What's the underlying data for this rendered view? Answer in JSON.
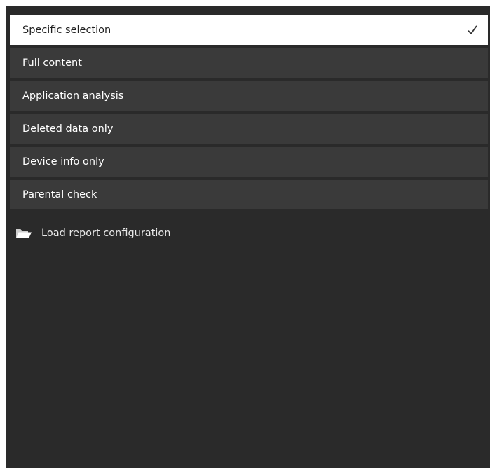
{
  "report_options": {
    "items": [
      {
        "label": "Specific selection",
        "selected": true
      },
      {
        "label": "Full content",
        "selected": false
      },
      {
        "label": "Application analysis",
        "selected": false
      },
      {
        "label": "Deleted data only",
        "selected": false
      },
      {
        "label": "Device info only",
        "selected": false
      },
      {
        "label": "Parental check",
        "selected": false
      }
    ],
    "selected_icon": "checkmark-icon"
  },
  "load_config": {
    "label": "Load report configuration",
    "icon": "folder-open-icon"
  },
  "colors": {
    "panel_background": "#2a2a2a",
    "option_background": "#3a3a3a",
    "selected_background": "#ffffff",
    "text_light": "#ffffff",
    "text_dark": "#1f1f1f"
  }
}
